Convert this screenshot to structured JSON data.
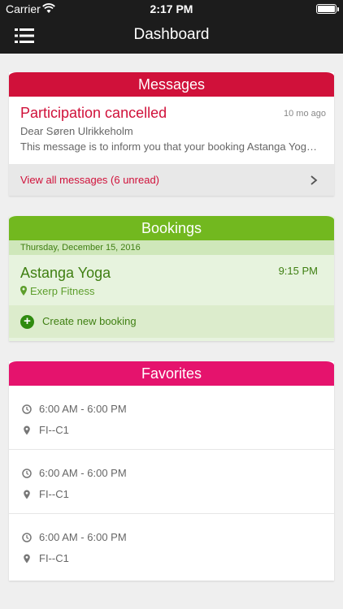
{
  "status_bar": {
    "carrier": "Carrier",
    "time": "2:17 PM"
  },
  "nav": {
    "title": "Dashboard"
  },
  "messages": {
    "header": "Messages",
    "item": {
      "title": "Participation cancelled",
      "time": "10 mo ago",
      "from": "Dear Søren Ulrikkeholm",
      "body": "This message is to inform you that your booking Astanga Yoga has been cancelled."
    },
    "footer": "View all messages (6 unread)"
  },
  "bookings": {
    "header": "Bookings",
    "date": "Thursday, December 15, 2016",
    "item": {
      "class_name": "Astanga Yoga",
      "time": "9:15 PM",
      "location": "Exerp Fitness"
    },
    "create_label": "Create new booking"
  },
  "favorites": {
    "header": "Favorites",
    "items": [
      {
        "time": "6:00 AM - 6:00 PM",
        "location": "FI--C1"
      },
      {
        "time": "6:00 AM - 6:00 PM",
        "location": "FI--C1"
      },
      {
        "time": "6:00 AM - 6:00 PM",
        "location": "FI--C1"
      }
    ]
  },
  "colors": {
    "messages_accent": "#d0113a",
    "bookings_accent": "#72b81f",
    "favorites_accent": "#e5136d",
    "nav_background": "#1c1c1c"
  },
  "icons": {
    "status_wifi": "wifi-icon",
    "status_battery": "battery-icon",
    "nav_menu": "list-menu-icon",
    "messages_chevron": "chevron-right-icon",
    "booking_location": "location-pin-icon",
    "create_booking": "plus-circle-icon",
    "favorite_time": "clock-icon",
    "favorite_location": "location-pin-icon"
  }
}
